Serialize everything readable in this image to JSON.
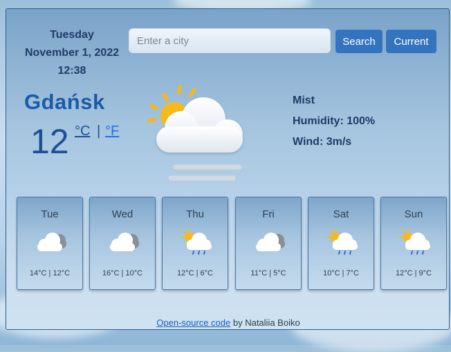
{
  "header": {
    "day": "Tuesday",
    "date": "November 1, 2022",
    "time": "12:38"
  },
  "search": {
    "placeholder": "Enter a city",
    "search_label": "Search",
    "current_label": "Current"
  },
  "current": {
    "city": "Gdańsk",
    "temperature": "12",
    "unit_c": "°C",
    "unit_separator": "|",
    "unit_f": "°F",
    "icon": "sun-cloud-mist-icon",
    "description": "Mist",
    "humidity": "Humidity: 100%",
    "wind": "Wind: 3m/s"
  },
  "forecast": [
    {
      "day": "Tue",
      "temps": "14°C | 12°C",
      "icon": "cloud-icon"
    },
    {
      "day": "Wed",
      "temps": "16°C | 10°C",
      "icon": "cloud-icon"
    },
    {
      "day": "Thu",
      "temps": "12°C | 6°C",
      "icon": "sun-rain-cloud-icon"
    },
    {
      "day": "Fri",
      "temps": "11°C | 5°C",
      "icon": "cloud-icon"
    },
    {
      "day": "Sat",
      "temps": "10°C | 7°C",
      "icon": "sun-rain-cloud-icon"
    },
    {
      "day": "Sun",
      "temps": "12°C | 9°C",
      "icon": "sun-rain-cloud-icon"
    }
  ],
  "footer": {
    "link_text": "Open-source code",
    "author": " by Nataliia Boiko"
  },
  "colors": {
    "accent": "#3474bf",
    "city": "#1b5aa6",
    "text_dark": "#1f3b66"
  }
}
